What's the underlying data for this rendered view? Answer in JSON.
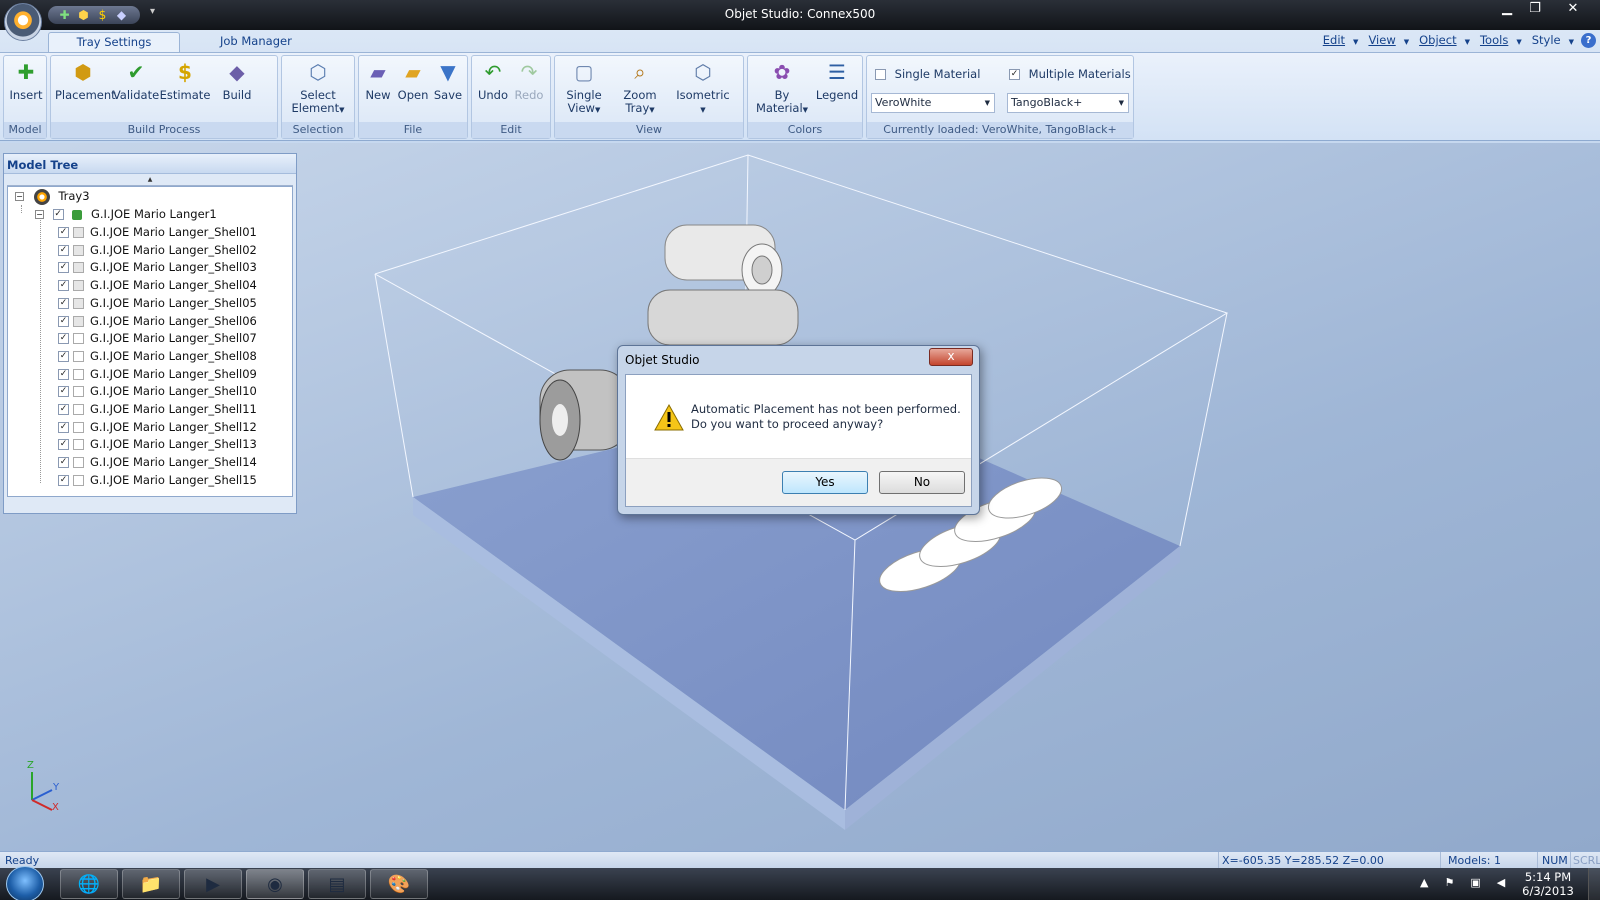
{
  "window": {
    "title": "Objet Studio: Connex500"
  },
  "quick_access": {
    "icons": [
      "insert-icon",
      "placement-icon",
      "estimate-icon",
      "build-icon"
    ]
  },
  "ribbon": {
    "tabs": [
      {
        "label": "Tray Settings",
        "active": true
      },
      {
        "label": "Job Manager",
        "active": false
      }
    ],
    "menus": [
      "Edit",
      "View",
      "Object",
      "Tools",
      "Style"
    ],
    "groups": {
      "model": {
        "label": "Model",
        "insert": "Insert"
      },
      "build_process": {
        "label": "Build Process",
        "placement": "Placement",
        "validate": "Validate",
        "estimate": "Estimate",
        "build": "Build"
      },
      "selection": {
        "label": "Selection",
        "select_element_1": "Select",
        "select_element_2": "Element"
      },
      "file": {
        "label": "File",
        "new": "New",
        "open": "Open",
        "save": "Save"
      },
      "edit": {
        "label": "Edit",
        "undo": "Undo",
        "redo": "Redo"
      },
      "view": {
        "label": "View",
        "single_view_1": "Single",
        "single_view_2": "View",
        "zoom_tray_1": "Zoom",
        "zoom_tray_2": "Tray",
        "isometric": "Isometric"
      },
      "colors": {
        "label": "Colors",
        "by_material_1": "By",
        "by_material_2": "Material",
        "legend": "Legend"
      },
      "materials": {
        "label": "Currently loaded: VeroWhite, TangoBlack+",
        "single_material": "Single Material",
        "single_checked": false,
        "multiple_materials": "Multiple Materials",
        "multiple_checked": true,
        "material1": "VeroWhite",
        "material2": "TangoBlack+"
      }
    }
  },
  "model_tree": {
    "title": "Model Tree",
    "tray": "Tray3",
    "model": "G.I.JOE Mario Langer1",
    "shells": [
      "G.I.JOE Mario Langer_Shell01",
      "G.I.JOE Mario Langer_Shell02",
      "G.I.JOE Mario Langer_Shell03",
      "G.I.JOE Mario Langer_Shell04",
      "G.I.JOE Mario Langer_Shell05",
      "G.I.JOE Mario Langer_Shell06",
      "G.I.JOE Mario Langer_Shell07",
      "G.I.JOE Mario Langer_Shell08",
      "G.I.JOE Mario Langer_Shell09",
      "G.I.JOE Mario Langer_Shell10",
      "G.I.JOE Mario Langer_Shell11",
      "G.I.JOE Mario Langer_Shell12",
      "G.I.JOE Mario Langer_Shell13",
      "G.I.JOE Mario Langer_Shell14",
      "G.I.JOE Mario Langer_Shell15"
    ]
  },
  "axis": {
    "z": "Z",
    "y": "Y",
    "x": "X"
  },
  "dialog": {
    "title": "Objet Studio",
    "close": "x",
    "message_line1": "Automatic Placement has not been performed.",
    "message_line2": "Do you want to proceed anyway?",
    "yes": "Yes",
    "no": "No"
  },
  "status": {
    "left": "Ready",
    "coords": "X=-605.35 Y=285.52 Z=0.00",
    "models": "Models: 1",
    "num": "NUM",
    "scrl": "SCRL"
  },
  "taskbar": {
    "items": [
      "chrome-icon",
      "file-explorer-icon",
      "media-player-icon",
      "objet-studio-icon",
      "task-manager-icon",
      "paint-icon"
    ],
    "time": "5:14 PM",
    "date": "6/3/2013"
  },
  "colors": {
    "ribbon_bg": "#dbe7f6",
    "viewport_bg": "#9fb6d6",
    "tray_platform": "#7f97c9",
    "accent": "#15428b"
  }
}
